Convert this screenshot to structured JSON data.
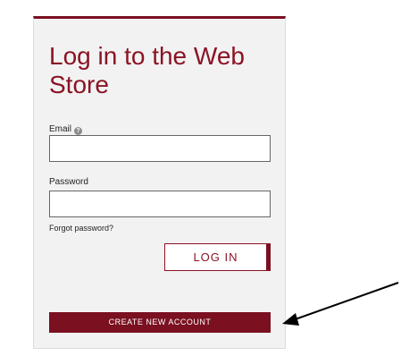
{
  "login_card": {
    "title": "Log in to the Web Store",
    "email_label": "Email",
    "email_help_icon": "help-icon",
    "email_value": "",
    "password_label": "Password",
    "password_value": "",
    "forgot_link": "Forgot password?",
    "login_button": "LOG IN",
    "create_account_button": "CREATE NEW ACCOUNT"
  },
  "annotation": {
    "arrow_icon": "arrow-icon"
  },
  "colors": {
    "brand": "#7a1020",
    "title": "#8a1424",
    "card_background": "#f2f2f2"
  }
}
